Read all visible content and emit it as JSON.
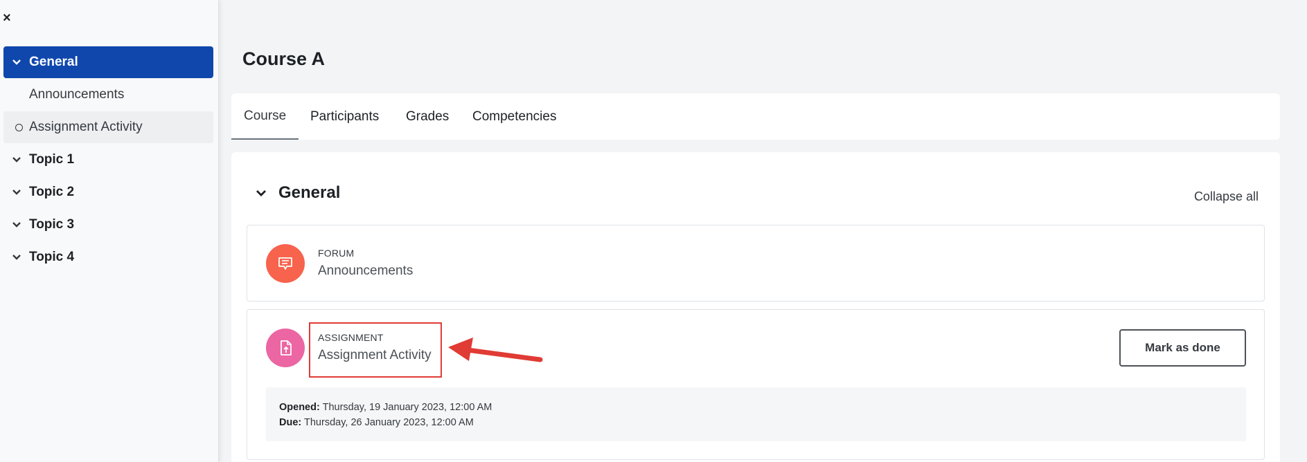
{
  "sidebar": {
    "close_icon": "×",
    "items": [
      {
        "label": "General"
      },
      {
        "label": "Announcements"
      },
      {
        "label": "Assignment Activity"
      },
      {
        "label": "Topic 1"
      },
      {
        "label": "Topic 2"
      },
      {
        "label": "Topic 3"
      },
      {
        "label": "Topic 4"
      }
    ]
  },
  "page": {
    "title": "Course A"
  },
  "tabs": [
    {
      "label": "Course"
    },
    {
      "label": "Participants"
    },
    {
      "label": "Grades"
    },
    {
      "label": "Competencies"
    }
  ],
  "section": {
    "title": "General",
    "collapse_all": "Collapse all"
  },
  "activities": [
    {
      "type": "FORUM",
      "name": "Announcements",
      "icon": "forum-icon",
      "color": "#f7634d"
    },
    {
      "type": "ASSIGNMENT",
      "name": "Assignment Activity",
      "icon": "assignment-icon",
      "color": "#eb66a2",
      "mark_done": "Mark as done",
      "opened_label": "Opened:",
      "opened_value": "Thursday, 19 January 2023, 12:00 AM",
      "due_label": "Due:",
      "due_value": "Thursday, 26 January 2023, 12:00 AM"
    }
  ],
  "colors": {
    "accent": "#0f47ad",
    "annotation": "#e03b34"
  }
}
